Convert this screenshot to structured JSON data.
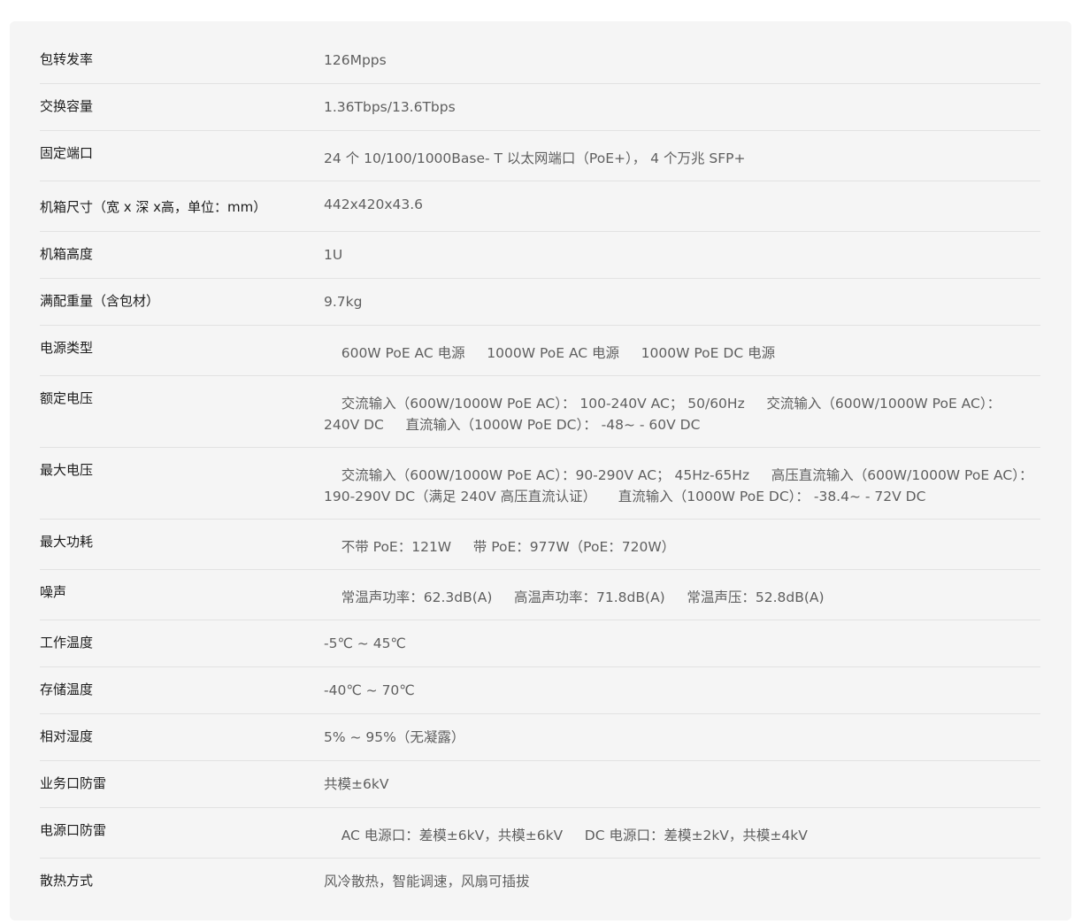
{
  "specs": [
    {
      "label": "包转发率",
      "value": "126Mpps"
    },
    {
      "label": "交换容量",
      "value": "1.36Tbps/13.6Tbps"
    },
    {
      "label": "固定端口",
      "value": "24 个 10/100/1000Base- T 以太网端口（PoE+）， 4 个万兆 SFP+"
    },
    {
      "label": "机箱尺寸（宽 x 深 x高，单位：mm）",
      "value": "442x420x43.6"
    },
    {
      "label": "机箱高度",
      "value": "1U"
    },
    {
      "label": "满配重量（含包材）",
      "value": "9.7kg"
    },
    {
      "label": "电源类型",
      "value": "    600W PoE AC 电源     1000W PoE AC 电源     1000W PoE DC 电源"
    },
    {
      "label": "额定电压",
      "value": "    交流输入（600W/1000W PoE AC）： 100-240V AC； 50/60Hz     交流输入（600W/1000W PoE AC）： 240V DC     直流输入（1000W PoE DC）： -48~ - 60V DC"
    },
    {
      "label": "最大电压",
      "value": "    交流输入（600W/1000W PoE AC）：90-290V AC； 45Hz-65Hz     高压直流输入（600W/1000W PoE AC）：190-290V DC（满足 240V 高压直流认证）     直流输入（1000W PoE DC）： -38.4~ - 72V DC"
    },
    {
      "label": "最大功耗",
      "value": "    不带 PoE：121W     带 PoE：977W（PoE：720W）"
    },
    {
      "label": "噪声",
      "value": "    常温声功率：62.3dB(A)     高温声功率：71.8dB(A)     常温声压：52.8dB(A)"
    },
    {
      "label": "工作温度",
      "value": "-5℃ ~ 45℃"
    },
    {
      "label": "存储温度",
      "value": "-40℃ ~ 70℃"
    },
    {
      "label": "相对湿度",
      "value": "5% ~ 95%（无凝露）"
    },
    {
      "label": "业务口防雷",
      "value": "共模±6kV"
    },
    {
      "label": "电源口防雷",
      "value": "    AC 电源口：差模±6kV，共模±6kV     DC 电源口：差模±2kV，共模±4kV"
    },
    {
      "label": "散热方式",
      "value": "风冷散热，智能调速，风扇可插拔"
    }
  ]
}
